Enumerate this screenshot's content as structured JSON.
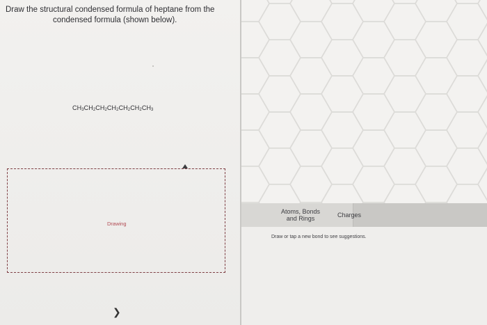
{
  "question": {
    "line1": "Draw the structural condensed formula of heptane from the",
    "line2": "condensed formula (shown below)."
  },
  "formula": {
    "groups": [
      "CH",
      "3",
      "CH",
      "2",
      "CH",
      "2",
      "CH",
      "2",
      "CH",
      "2",
      "CH",
      "2",
      "CH",
      "3"
    ]
  },
  "drawing_area": {
    "label": "Drawing"
  },
  "navigation": {
    "next_icon": "chevron-right-icon"
  },
  "toolbar": {
    "atoms_tab": "Atoms, Bonds and Rings",
    "charges_tab": "Charges"
  },
  "hint": {
    "text": "Draw or tap a new bond to see suggestions."
  },
  "colors": {
    "drawing_border": "#7f3f44",
    "drawing_label": "#b14a52"
  }
}
